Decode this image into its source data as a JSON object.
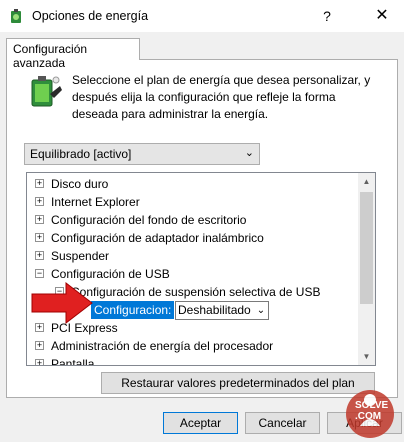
{
  "window": {
    "title": "Opciones de energía",
    "help": "?",
    "close": "✕"
  },
  "tab": {
    "label": "Configuración avanzada"
  },
  "description": "Seleccione el plan de energía que desea personalizar, y después elija la configuración que refleje la forma deseada para administrar la energía.",
  "plan_select": {
    "value": "Equilibrado [activo]"
  },
  "tree": {
    "items": [
      {
        "expander": "+",
        "label": "Disco duro"
      },
      {
        "expander": "+",
        "label": "Internet Explorer"
      },
      {
        "expander": "+",
        "label": "Configuración del fondo de escritorio"
      },
      {
        "expander": "+",
        "label": "Configuración de adaptador inalámbrico"
      },
      {
        "expander": "+",
        "label": "Suspender"
      },
      {
        "expander": "−",
        "label": "Configuración de USB"
      },
      {
        "expander": "−",
        "label": "Configuración de suspensión selectiva de USB"
      },
      {
        "expander": "",
        "label": ""
      },
      {
        "expander": "+",
        "label": "PCI Express"
      },
      {
        "expander": "+",
        "label": "Administración de energía del procesador"
      },
      {
        "expander": "+",
        "label": "Pantalla"
      }
    ],
    "setting_label": "Configuracion:",
    "setting_value": "Deshabilitado"
  },
  "buttons": {
    "restore": "Restaurar valores predeterminados del plan",
    "ok": "Aceptar",
    "cancel": "Cancelar",
    "apply": "Aplicar"
  },
  "watermark": {
    "line1": "SOLVE",
    "line2": ".COM"
  },
  "colors": {
    "highlight": "#0078d7",
    "arrow": "#e02020",
    "watermark": "#c0392b"
  },
  "icons": [
    "power-options-icon",
    "battery-plan-icon",
    "help-icon",
    "close-icon",
    "chevron-down-icon",
    "red-arrow-icon"
  ]
}
